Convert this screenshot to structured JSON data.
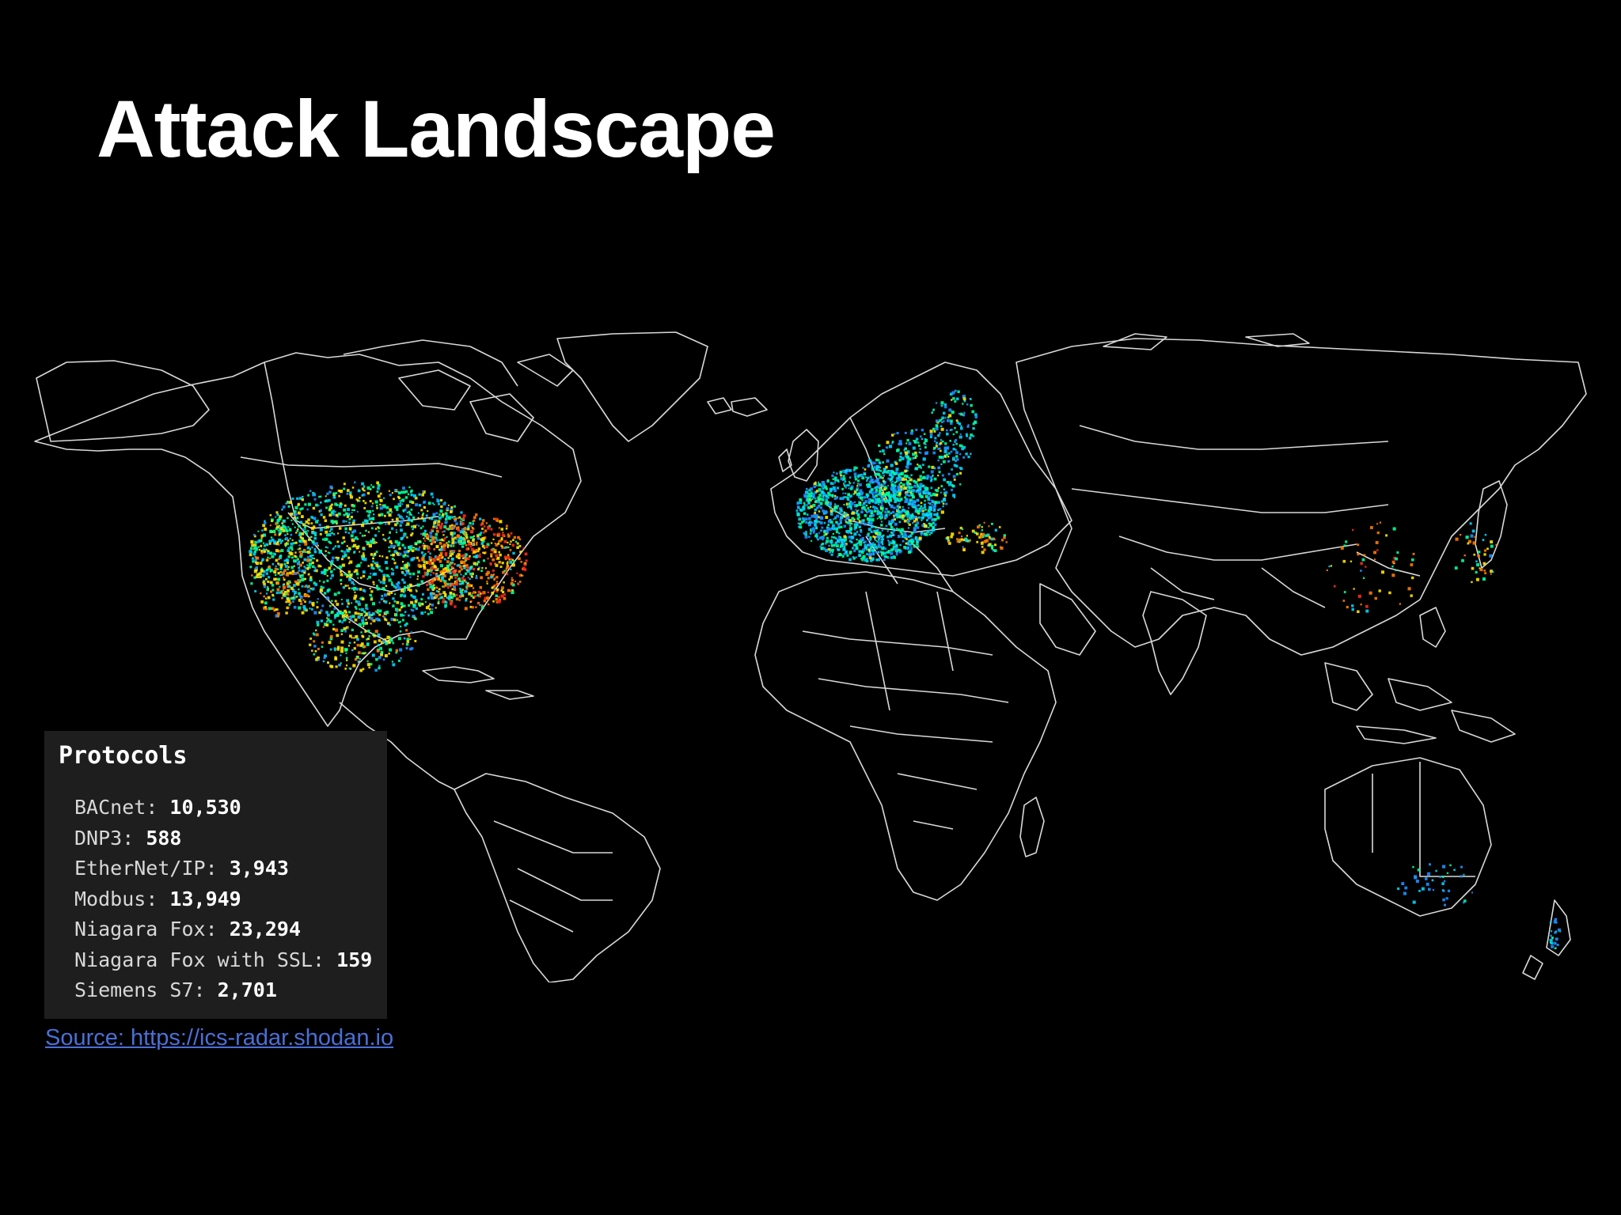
{
  "slide": {
    "title": "Attack Landscape"
  },
  "legend": {
    "title": "Protocols",
    "items": [
      {
        "protocol": "BACnet",
        "separator": ": ",
        "count": "10,530"
      },
      {
        "protocol": "DNP3",
        "separator": ": ",
        "count": "588"
      },
      {
        "protocol": "EtherNet/IP",
        "separator": ": ",
        "count": "3,943"
      },
      {
        "protocol": "Modbus",
        "separator": ": ",
        "count": "13,949"
      },
      {
        "protocol": "Niagara Fox",
        "separator": ": ",
        "count": "23,294"
      },
      {
        "protocol": "Niagara Fox with SSL",
        "separator": ": ",
        "count": "159"
      },
      {
        "protocol": "Siemens S7",
        "separator": ": ",
        "count": "2,701"
      }
    ]
  },
  "source": {
    "text": "Source: https://ics-radar.shodan.io"
  },
  "map": {
    "background_color": "#000000",
    "outline_color": "#d9d9d9",
    "density_colors": [
      "#1e90ff",
      "#00d5ff",
      "#00ff9a",
      "#ffe600",
      "#ff7a00",
      "#ff2a1a"
    ]
  }
}
